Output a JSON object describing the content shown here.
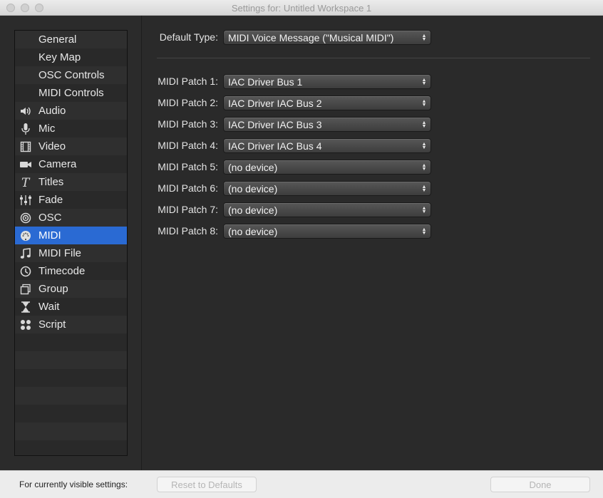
{
  "window": {
    "title": "Settings for: Untitled Workspace 1"
  },
  "sidebar": {
    "items": [
      {
        "label": "General",
        "icon": "none"
      },
      {
        "label": "Key Map",
        "icon": "none"
      },
      {
        "label": "OSC Controls",
        "icon": "none"
      },
      {
        "label": "MIDI Controls",
        "icon": "none"
      },
      {
        "label": "Audio",
        "icon": "speaker-icon"
      },
      {
        "label": "Mic",
        "icon": "microphone-icon"
      },
      {
        "label": "Video",
        "icon": "film-icon"
      },
      {
        "label": "Camera",
        "icon": "camera-icon"
      },
      {
        "label": "Titles",
        "icon": "titles-icon"
      },
      {
        "label": "Fade",
        "icon": "fader-icon"
      },
      {
        "label": "OSC",
        "icon": "osc-icon"
      },
      {
        "label": "MIDI",
        "icon": "midi-icon"
      },
      {
        "label": "MIDI File",
        "icon": "music-note-icon"
      },
      {
        "label": "Timecode",
        "icon": "clock-icon"
      },
      {
        "label": "Group",
        "icon": "group-icon"
      },
      {
        "label": "Wait",
        "icon": "hourglass-icon"
      },
      {
        "label": "Script",
        "icon": "script-icon"
      }
    ],
    "selected": "MIDI",
    "selected_color": "#2a6ad3"
  },
  "settings": {
    "default_type": {
      "label": "Default Type:",
      "value": "MIDI Voice Message (\"Musical MIDI\")"
    },
    "patches": [
      {
        "label": "MIDI Patch 1:",
        "value": "IAC Driver Bus 1"
      },
      {
        "label": "MIDI Patch 2:",
        "value": "IAC Driver IAC Bus 2"
      },
      {
        "label": "MIDI Patch 3:",
        "value": "IAC Driver IAC Bus 3"
      },
      {
        "label": "MIDI Patch 4:",
        "value": "IAC Driver IAC Bus 4"
      },
      {
        "label": "MIDI Patch 5:",
        "value": "(no device)"
      },
      {
        "label": "MIDI Patch 6:",
        "value": "(no device)"
      },
      {
        "label": "MIDI Patch 7:",
        "value": "(no device)"
      },
      {
        "label": "MIDI Patch 8:",
        "value": "(no device)"
      }
    ]
  },
  "footer": {
    "label": "For currently visible settings:",
    "reset_label": "Reset to Defaults",
    "done_label": "Done"
  }
}
